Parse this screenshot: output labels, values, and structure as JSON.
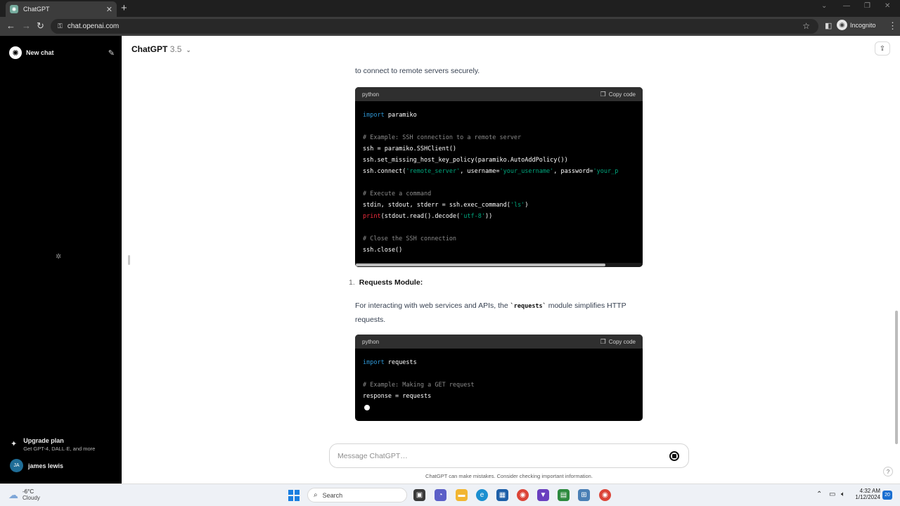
{
  "browser": {
    "tab_title": "ChatGPT",
    "tab_close": "✕",
    "new_tab": "+",
    "url": "chat.openai.com",
    "incognito_label": "Incognito"
  },
  "sidebar": {
    "new_chat_label": "New chat",
    "upgrade_title": "Upgrade plan",
    "upgrade_subtitle": "Get GPT-4, DALL·E, and more",
    "user_initials": "JA",
    "user_name": "james lewis"
  },
  "header": {
    "model_name": "ChatGPT",
    "model_version": "3.5"
  },
  "content": {
    "intro_text": "to connect to remote servers securely.",
    "code_block_1": {
      "language": "python",
      "copy_label": "Copy code",
      "lines": {
        "l1_kw": "import",
        "l1_rest": " paramiko",
        "l3": "# Example: SSH connection to a remote server",
        "l4": "ssh = paramiko.SSHClient()",
        "l5": "ssh.set_missing_host_key_policy(paramiko.AutoAddPolicy())",
        "l6_a": "ssh.connect(",
        "l6_s1": "'remote_server'",
        "l6_b": ", username=",
        "l6_s2": "'your_username'",
        "l6_c": ", password=",
        "l6_s3": "'your_p",
        "l8": "# Execute a command",
        "l9_a": "stdin, stdout, stderr = ssh.exec_command(",
        "l9_s": "'ls'",
        "l9_b": ")",
        "l10_fn": "print",
        "l10_a": "(stdout.read().decode(",
        "l10_s": "'utf-8'",
        "l10_b": "))",
        "l12": "# Close the SSH connection",
        "l13": "ssh.close()"
      }
    },
    "list_item": {
      "number": "1.",
      "label": "Requests Module:"
    },
    "requests_text_a": "For interacting with web services and APIs, the ",
    "requests_code": "`requests`",
    "requests_text_b": " module simplifies HTTP",
    "requests_text_c": "requests.",
    "code_block_2": {
      "language": "python",
      "copy_label": "Copy code",
      "lines": {
        "l1_kw": "import",
        "l1_rest": " requests",
        "l3": "# Example: Making a GET request",
        "l4": "response = requests"
      }
    }
  },
  "composer": {
    "placeholder": "Message ChatGPT…",
    "disclaimer": "ChatGPT can make mistakes. Consider checking important information.",
    "help": "?"
  },
  "taskbar": {
    "temperature": "-6°C",
    "condition": "Cloudy",
    "search_label": "Search",
    "time": "4:32 AM",
    "date": "1/12/2024",
    "notifications": "20"
  },
  "colors": {
    "sidebar_bg": "#000000",
    "code_bg": "#000000",
    "code_header_bg": "#2f2f2f",
    "keyword": "#2e95d3",
    "string": "#00a67d",
    "comment": "#8b8b8b",
    "builtin": "#f22c3d"
  }
}
